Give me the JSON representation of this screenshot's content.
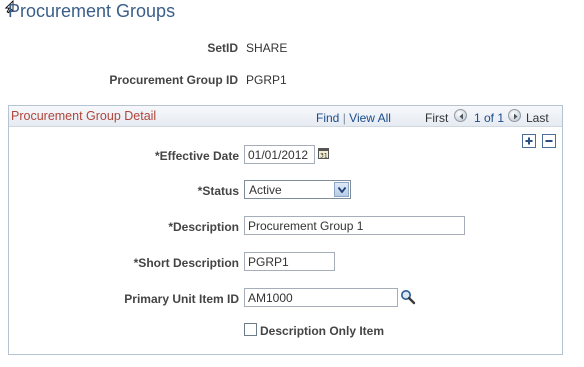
{
  "page": {
    "title": "Procurement Groups"
  },
  "keys": {
    "setid_label": "SetID",
    "setid_value": "SHARE",
    "group_id_label": "Procurement Group ID",
    "group_id_value": "PGRP1"
  },
  "detail": {
    "title": "Procurement Group Detail",
    "nav": {
      "find": "Find",
      "separator": "|",
      "view_all": "View All",
      "first": "First",
      "range": "1 of 1",
      "last": "Last"
    },
    "fields": {
      "effective_date_label": "*Effective Date",
      "effective_date_value": "01/01/2012",
      "status_label": "*Status",
      "status_value": "Active",
      "description_label": "*Description",
      "description_value": "Procurement Group 1",
      "short_description_label": "*Short Description",
      "short_description_value": "PGRP1",
      "primary_unit_label": "Primary Unit Item ID",
      "primary_unit_value": "AM1000",
      "description_only_label": "Description Only Item",
      "description_only_checked": false
    }
  },
  "colors": {
    "title": "#3a5e8a",
    "group_title": "#b0463b",
    "link": "#1b4c8c",
    "border": "#b5c3d3"
  },
  "icons": [
    "mouse-cursor-icon",
    "prev-arrow-icon",
    "next-arrow-icon",
    "add-row-icon",
    "delete-row-icon",
    "calendar-icon",
    "dropdown-arrow-icon",
    "lookup-magnifier-icon"
  ]
}
